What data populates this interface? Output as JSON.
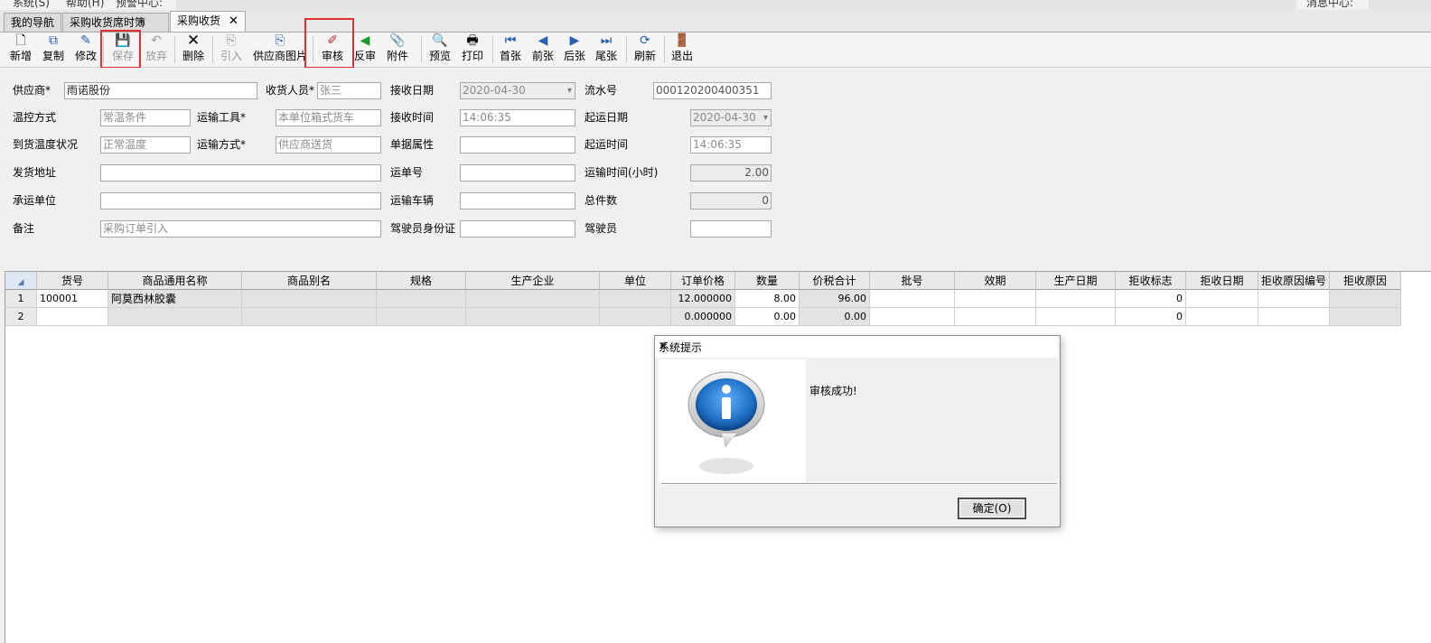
{
  "menu": {
    "fragments": [
      "系统(S)",
      "帮助(H)",
      "预警中心:",
      "消息中心:"
    ]
  },
  "tabs": [
    {
      "label": "我的导航"
    },
    {
      "label": "采购收货席时簿"
    },
    {
      "label": "采购收货",
      "close": "✕"
    }
  ],
  "toolbar": {
    "new": "新增",
    "copy": "复制",
    "edit": "修改",
    "save": "保存",
    "discard": "放弃",
    "delete": "删除",
    "import": "引入",
    "supplier_image": "供应商图片",
    "audit": "审核",
    "unaudit": "反审",
    "attachment": "附件",
    "preview": "预览",
    "print": "打印",
    "first": "首张",
    "prev": "前张",
    "next": "后张",
    "last": "尾张",
    "refresh": "刷新",
    "exit": "退出"
  },
  "form": {
    "supplier": {
      "label": "供应商*",
      "value": "雨诺股份"
    },
    "receiver": {
      "label": "收货人员*",
      "value": "张三"
    },
    "receive_date": {
      "label": "接收日期",
      "value": "2020-04-30"
    },
    "serial_no": {
      "label": "流水号",
      "value": "000120200400351"
    },
    "temp_control": {
      "label": "温控方式",
      "value": "常温条件"
    },
    "transport_tool": {
      "label": "运输工具*",
      "value": "本单位箱式货车"
    },
    "receive_time": {
      "label": "接收时间",
      "value": "14:06:35"
    },
    "ship_date": {
      "label": "起运日期",
      "value": "2020-04-30"
    },
    "arrival_temp": {
      "label": "到货温度状况",
      "value": "正常温度"
    },
    "transport_mode": {
      "label": "运输方式*",
      "value": "供应商送货"
    },
    "doc_attr": {
      "label": "单据属性",
      "value": ""
    },
    "ship_time": {
      "label": "起运时间",
      "value": "14:06:35"
    },
    "ship_address": {
      "label": "发货地址",
      "value": ""
    },
    "waybill_no": {
      "label": "运单号",
      "value": ""
    },
    "transport_hours": {
      "label": "运输时间(小时)",
      "value": "2.00"
    },
    "carrier": {
      "label": "承运单位",
      "value": ""
    },
    "vehicle": {
      "label": "运输车辆",
      "value": ""
    },
    "total_pieces": {
      "label": "总件数",
      "value": "0"
    },
    "remark": {
      "label": "备注",
      "value": "采购订单引入"
    },
    "driver_id": {
      "label": "驾驶员身份证",
      "value": ""
    },
    "driver": {
      "label": "驾驶员",
      "value": ""
    }
  },
  "grid": {
    "headers": [
      "货号",
      "商品通用名称",
      "商品别名",
      "规格",
      "生产企业",
      "单位",
      "订单价格",
      "数量",
      "价税合计",
      "批号",
      "效期",
      "生产日期",
      "拒收标志",
      "拒收日期",
      "拒收原因编号",
      "拒收原因"
    ],
    "rows": [
      {
        "no": "1",
        "code": "100001",
        "name": "阿莫西林胶囊",
        "alias": "",
        "spec": "",
        "maker": "",
        "unit": "",
        "price": "12.000000",
        "qty": "8.00",
        "total": "96.00",
        "batch": "",
        "expiry": "",
        "mfg_date": "",
        "reject_flag": "0",
        "reject_date": "",
        "reject_code": "",
        "reject_reason": ""
      },
      {
        "no": "2",
        "code": "",
        "name": "",
        "alias": "",
        "spec": "",
        "maker": "",
        "unit": "",
        "price": "0.000000",
        "qty": "0.00",
        "total": "0.00",
        "batch": "",
        "expiry": "",
        "mfg_date": "",
        "reject_flag": "0",
        "reject_date": "",
        "reject_code": "",
        "reject_reason": ""
      }
    ]
  },
  "dialog": {
    "title": "系统提示",
    "close": "✕",
    "message": "审核成功!",
    "ok_label": "确定(O)",
    "icon": "info-icon"
  },
  "colors": {
    "highlight": "#e03030",
    "info_blue": "#1e6fc4"
  }
}
